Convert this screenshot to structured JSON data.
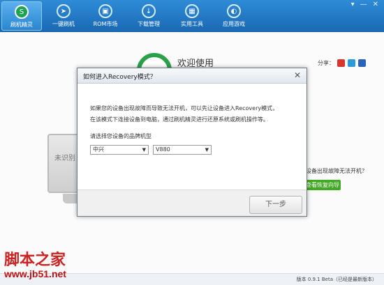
{
  "nav": {
    "items": [
      {
        "label": "刷机精灵",
        "icon": "logo-icon",
        "active": true
      },
      {
        "label": "一键刷机",
        "icon": "cursor-icon"
      },
      {
        "label": "ROM市场",
        "icon": "market-icon"
      },
      {
        "label": "下载管理",
        "icon": "download-icon"
      },
      {
        "label": "实用工具",
        "icon": "tools-icon"
      },
      {
        "label": "应用游戏",
        "icon": "apps-icon"
      }
    ],
    "window_controls": [
      "▾",
      "—",
      "✕"
    ]
  },
  "background": {
    "welcome": "欢迎使用",
    "share_label": "分享：",
    "unrecognized": "未识别",
    "fault_text": "设备出现故障无法开机？",
    "guide_button": "查看恢复向导"
  },
  "dialog": {
    "title": "如何进入Recovery模式？",
    "body_line1": "如果您的设备出现故障而导致无法开机，可以先让设备进入Recovery模式，",
    "body_line2": "在该模式下连接设备到电脑，通过刷机精灵进行还原系统或刷机操作等。",
    "select_label": "请选择您设备的品牌机型",
    "brand_value": "中兴",
    "model_value": "V880",
    "next_label": "下一步"
  },
  "status": {
    "version": "版本 0.9.1 Beta（已经是最新版本）"
  },
  "watermark": {
    "line1": "脚本之家",
    "line2": "www.jb51.net"
  },
  "colors": {
    "toolbar": "#1f74c2",
    "accent_green": "#43a924"
  }
}
